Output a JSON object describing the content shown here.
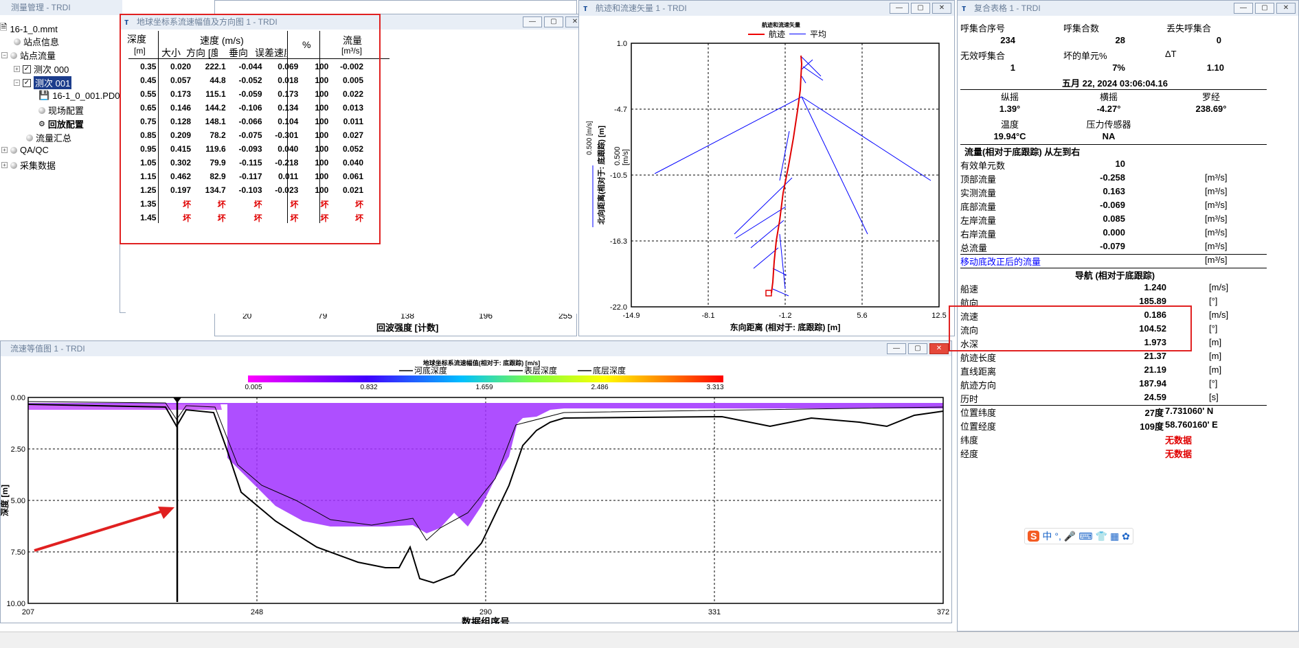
{
  "tree": {
    "title": "测量管理 - TRDI",
    "file": "16-1_0.mmt",
    "items": [
      "站点信息",
      "站点流量",
      "测次 000",
      "测次 001",
      "16-1_0_001.PD0",
      "现场配置",
      "回放配置",
      "流量汇总",
      "QA/QC",
      "采集数据"
    ]
  },
  "vel_table": {
    "title": "地球坐标系流速幅值及方向图 1 - TRDI",
    "headers": {
      "depth": "深度",
      "depth_unit": "[m]",
      "speed": "速度 (m/s)",
      "mag": "大小",
      "dir": "方向 [度]",
      "vert": "垂向",
      "err": "误差速度",
      "pct": "%",
      "flow": "流量",
      "flow_unit": "[m³/s]"
    },
    "rows": [
      [
        "0.35",
        "0.020",
        "222.1",
        "-0.044",
        "0.069",
        "100",
        "-0.002"
      ],
      [
        "0.45",
        "0.057",
        "44.8",
        "-0.052",
        "0.018",
        "100",
        "0.005"
      ],
      [
        "0.55",
        "0.173",
        "115.1",
        "-0.059",
        "0.173",
        "100",
        "0.022"
      ],
      [
        "0.65",
        "0.146",
        "144.2",
        "-0.106",
        "0.134",
        "100",
        "0.013"
      ],
      [
        "0.75",
        "0.128",
        "148.1",
        "-0.066",
        "0.104",
        "100",
        "0.011"
      ],
      [
        "0.85",
        "0.209",
        "78.2",
        "-0.075",
        "-0.301",
        "100",
        "0.027"
      ],
      [
        "0.95",
        "0.415",
        "119.6",
        "-0.093",
        "0.040",
        "100",
        "0.052"
      ],
      [
        "1.05",
        "0.302",
        "79.9",
        "-0.115",
        "-0.218",
        "100",
        "0.040"
      ],
      [
        "1.15",
        "0.462",
        "82.9",
        "-0.117",
        "0.011",
        "100",
        "0.061"
      ],
      [
        "1.25",
        "0.197",
        "134.7",
        "-0.103",
        "-0.023",
        "100",
        "0.021"
      ],
      [
        "1.35",
        "坏",
        "坏",
        "坏",
        "坏",
        "坏",
        "坏"
      ],
      [
        "1.45",
        "坏",
        "坏",
        "坏",
        "坏",
        "坏",
        "坏"
      ]
    ]
  },
  "backscatter": {
    "ticks": [
      "20",
      "79",
      "138",
      "196",
      "255"
    ],
    "xlabel": "回波强度 [计数]"
  },
  "track": {
    "title": "航迹和流速矢量 1 - TRDI",
    "plot_title": "航迹和流速矢量",
    "legend": [
      "航迹",
      "平均"
    ],
    "xticks": [
      "-14.9",
      "-8.1",
      "-1.2",
      "5.6",
      "12.5"
    ],
    "yticks": [
      "1.0",
      "-4.7",
      "-10.5",
      "-16.3",
      "-22.0"
    ],
    "xlabel": "东向距离 (相对于: 底跟踪) [m]",
    "ylabel": "北向距离(相对于: 底跟踪) [m]",
    "scale": "0.500 [m/s]"
  },
  "contour": {
    "title": "流速等值图 1 - TRDI",
    "plot_title": "地球坐标系流速幅值(相对于: 底跟踪) [m/s]",
    "legend": [
      "河底深度",
      "表层深度",
      "底层深度"
    ],
    "colorbar_ticks": [
      "0.005",
      "0.832",
      "1.659",
      "2.486",
      "3.313"
    ],
    "yticks": [
      "0.00",
      "2.50",
      "5.00",
      "7.50",
      "10.00"
    ],
    "xticks": [
      "207",
      "248",
      "290",
      "331",
      "372"
    ],
    "xlabel": "数据组序号",
    "ylabel": "深度 [m]"
  },
  "summary": {
    "title": "复合表格 1 - TRDI",
    "ens_headers": [
      "呼集合序号",
      "呼集合数",
      "丢失呼集合"
    ],
    "ens_values": [
      "234",
      "28",
      "0"
    ],
    "ens_headers2": [
      "无效呼集合",
      "坏的单元%",
      "ΔT"
    ],
    "ens_values2": [
      "1",
      "7%",
      "1.10"
    ],
    "datetime": "五月 22, 2024  03:06:04.16",
    "att_headers": [
      "纵摇",
      "横摇",
      "罗经"
    ],
    "att_values": [
      "1.39°",
      "-4.27°",
      "238.69°"
    ],
    "temp_label": "温度",
    "temp": "19.94°C",
    "press_label": "压力传感器",
    "press": "NA",
    "flow_title": "流量(相对于底跟踪) 从左到右",
    "flow_rows": [
      [
        "有效单元数",
        "10",
        ""
      ],
      [
        "顶部流量",
        "-0.258",
        "[m³/s]"
      ],
      [
        "实测流量",
        "0.163",
        "[m³/s]"
      ],
      [
        "底部流量",
        "-0.069",
        "[m³/s]"
      ],
      [
        "左岸流量",
        "0.085",
        "[m³/s]"
      ],
      [
        "右岸流量",
        "0.000",
        "[m³/s]"
      ],
      [
        "总流量",
        "-0.079",
        "[m³/s]"
      ]
    ],
    "moving_bed": "移动底改正后的流量",
    "moving_bed_unit": "[m³/s]",
    "nav_title": "导航 (相对于底跟踪)",
    "nav_rows": [
      [
        "船速",
        "1.240",
        "[m/s]"
      ],
      [
        "航向",
        "185.89",
        "[°]"
      ],
      [
        "流速",
        "0.186",
        "[m/s]"
      ],
      [
        "流向",
        "104.52",
        "[°]"
      ],
      [
        "水深",
        "1.973",
        "[m]"
      ],
      [
        "航迹长度",
        "21.37",
        "[m]"
      ],
      [
        "直线距离",
        "21.19",
        "[m]"
      ],
      [
        "航迹方向",
        "187.94",
        "[°]"
      ],
      [
        "历时",
        "24.59",
        "[s]"
      ]
    ],
    "pos_rows": [
      [
        "位置纬度",
        "27度",
        "7.731060' N"
      ],
      [
        "位置经度",
        "109度",
        "58.760160' E"
      ]
    ],
    "nodata_rows": [
      [
        "纬度",
        "无数据"
      ],
      [
        "经度",
        "无数据"
      ]
    ]
  },
  "ime": {
    "text": "中"
  }
}
